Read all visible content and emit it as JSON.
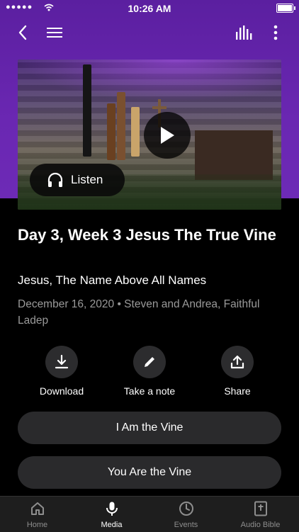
{
  "status": {
    "signal": "●●●●●",
    "time": "10:26 AM"
  },
  "nav": {
    "back_icon": "chevron-left-icon",
    "menu_icon": "hamburger-icon",
    "audio_icon": "equalizer-icon",
    "more_icon": "more-vertical-icon"
  },
  "player": {
    "listen_label": "Listen"
  },
  "sermon": {
    "title": "Day 3, Week 3 Jesus The True Vine",
    "series": "Jesus, The Name Above All Names",
    "meta": "December 16, 2020 • Steven and Andrea, Faithful Ladep"
  },
  "actions": [
    {
      "label": "Download",
      "icon": "download-icon"
    },
    {
      "label": "Take a note",
      "icon": "pencil-icon"
    },
    {
      "label": "Share",
      "icon": "share-icon"
    }
  ],
  "links": [
    "I Am the Vine",
    "You Are the Vine"
  ],
  "tabs": [
    {
      "label": "Home",
      "icon": "home-icon"
    },
    {
      "label": "Media",
      "icon": "microphone-icon"
    },
    {
      "label": "Events",
      "icon": "clock-icon"
    },
    {
      "label": "Audio Bible",
      "icon": "bible-icon"
    }
  ],
  "colors": {
    "header": "#6a27b2",
    "background": "#000000",
    "pill": "#2a2a2c",
    "tabbar": "#1e1e1e"
  }
}
